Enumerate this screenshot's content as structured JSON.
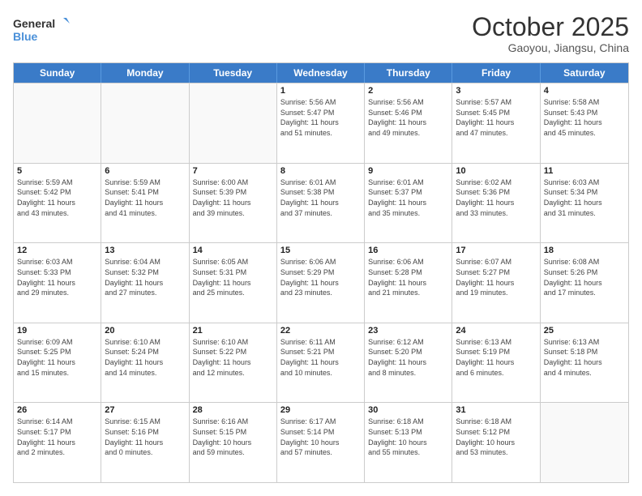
{
  "logo": {
    "line1": "General",
    "line2": "Blue"
  },
  "title": "October 2025",
  "subtitle": "Gaoyou, Jiangsu, China",
  "weekdays": [
    "Sunday",
    "Monday",
    "Tuesday",
    "Wednesday",
    "Thursday",
    "Friday",
    "Saturday"
  ],
  "weeks": [
    [
      {
        "day": "",
        "info": ""
      },
      {
        "day": "",
        "info": ""
      },
      {
        "day": "",
        "info": ""
      },
      {
        "day": "1",
        "info": "Sunrise: 5:56 AM\nSunset: 5:47 PM\nDaylight: 11 hours\nand 51 minutes."
      },
      {
        "day": "2",
        "info": "Sunrise: 5:56 AM\nSunset: 5:46 PM\nDaylight: 11 hours\nand 49 minutes."
      },
      {
        "day": "3",
        "info": "Sunrise: 5:57 AM\nSunset: 5:45 PM\nDaylight: 11 hours\nand 47 minutes."
      },
      {
        "day": "4",
        "info": "Sunrise: 5:58 AM\nSunset: 5:43 PM\nDaylight: 11 hours\nand 45 minutes."
      }
    ],
    [
      {
        "day": "5",
        "info": "Sunrise: 5:59 AM\nSunset: 5:42 PM\nDaylight: 11 hours\nand 43 minutes."
      },
      {
        "day": "6",
        "info": "Sunrise: 5:59 AM\nSunset: 5:41 PM\nDaylight: 11 hours\nand 41 minutes."
      },
      {
        "day": "7",
        "info": "Sunrise: 6:00 AM\nSunset: 5:39 PM\nDaylight: 11 hours\nand 39 minutes."
      },
      {
        "day": "8",
        "info": "Sunrise: 6:01 AM\nSunset: 5:38 PM\nDaylight: 11 hours\nand 37 minutes."
      },
      {
        "day": "9",
        "info": "Sunrise: 6:01 AM\nSunset: 5:37 PM\nDaylight: 11 hours\nand 35 minutes."
      },
      {
        "day": "10",
        "info": "Sunrise: 6:02 AM\nSunset: 5:36 PM\nDaylight: 11 hours\nand 33 minutes."
      },
      {
        "day": "11",
        "info": "Sunrise: 6:03 AM\nSunset: 5:34 PM\nDaylight: 11 hours\nand 31 minutes."
      }
    ],
    [
      {
        "day": "12",
        "info": "Sunrise: 6:03 AM\nSunset: 5:33 PM\nDaylight: 11 hours\nand 29 minutes."
      },
      {
        "day": "13",
        "info": "Sunrise: 6:04 AM\nSunset: 5:32 PM\nDaylight: 11 hours\nand 27 minutes."
      },
      {
        "day": "14",
        "info": "Sunrise: 6:05 AM\nSunset: 5:31 PM\nDaylight: 11 hours\nand 25 minutes."
      },
      {
        "day": "15",
        "info": "Sunrise: 6:06 AM\nSunset: 5:29 PM\nDaylight: 11 hours\nand 23 minutes."
      },
      {
        "day": "16",
        "info": "Sunrise: 6:06 AM\nSunset: 5:28 PM\nDaylight: 11 hours\nand 21 minutes."
      },
      {
        "day": "17",
        "info": "Sunrise: 6:07 AM\nSunset: 5:27 PM\nDaylight: 11 hours\nand 19 minutes."
      },
      {
        "day": "18",
        "info": "Sunrise: 6:08 AM\nSunset: 5:26 PM\nDaylight: 11 hours\nand 17 minutes."
      }
    ],
    [
      {
        "day": "19",
        "info": "Sunrise: 6:09 AM\nSunset: 5:25 PM\nDaylight: 11 hours\nand 15 minutes."
      },
      {
        "day": "20",
        "info": "Sunrise: 6:10 AM\nSunset: 5:24 PM\nDaylight: 11 hours\nand 14 minutes."
      },
      {
        "day": "21",
        "info": "Sunrise: 6:10 AM\nSunset: 5:22 PM\nDaylight: 11 hours\nand 12 minutes."
      },
      {
        "day": "22",
        "info": "Sunrise: 6:11 AM\nSunset: 5:21 PM\nDaylight: 11 hours\nand 10 minutes."
      },
      {
        "day": "23",
        "info": "Sunrise: 6:12 AM\nSunset: 5:20 PM\nDaylight: 11 hours\nand 8 minutes."
      },
      {
        "day": "24",
        "info": "Sunrise: 6:13 AM\nSunset: 5:19 PM\nDaylight: 11 hours\nand 6 minutes."
      },
      {
        "day": "25",
        "info": "Sunrise: 6:13 AM\nSunset: 5:18 PM\nDaylight: 11 hours\nand 4 minutes."
      }
    ],
    [
      {
        "day": "26",
        "info": "Sunrise: 6:14 AM\nSunset: 5:17 PM\nDaylight: 11 hours\nand 2 minutes."
      },
      {
        "day": "27",
        "info": "Sunrise: 6:15 AM\nSunset: 5:16 PM\nDaylight: 11 hours\nand 0 minutes."
      },
      {
        "day": "28",
        "info": "Sunrise: 6:16 AM\nSunset: 5:15 PM\nDaylight: 10 hours\nand 59 minutes."
      },
      {
        "day": "29",
        "info": "Sunrise: 6:17 AM\nSunset: 5:14 PM\nDaylight: 10 hours\nand 57 minutes."
      },
      {
        "day": "30",
        "info": "Sunrise: 6:18 AM\nSunset: 5:13 PM\nDaylight: 10 hours\nand 55 minutes."
      },
      {
        "day": "31",
        "info": "Sunrise: 6:18 AM\nSunset: 5:12 PM\nDaylight: 10 hours\nand 53 minutes."
      },
      {
        "day": "",
        "info": ""
      }
    ]
  ]
}
